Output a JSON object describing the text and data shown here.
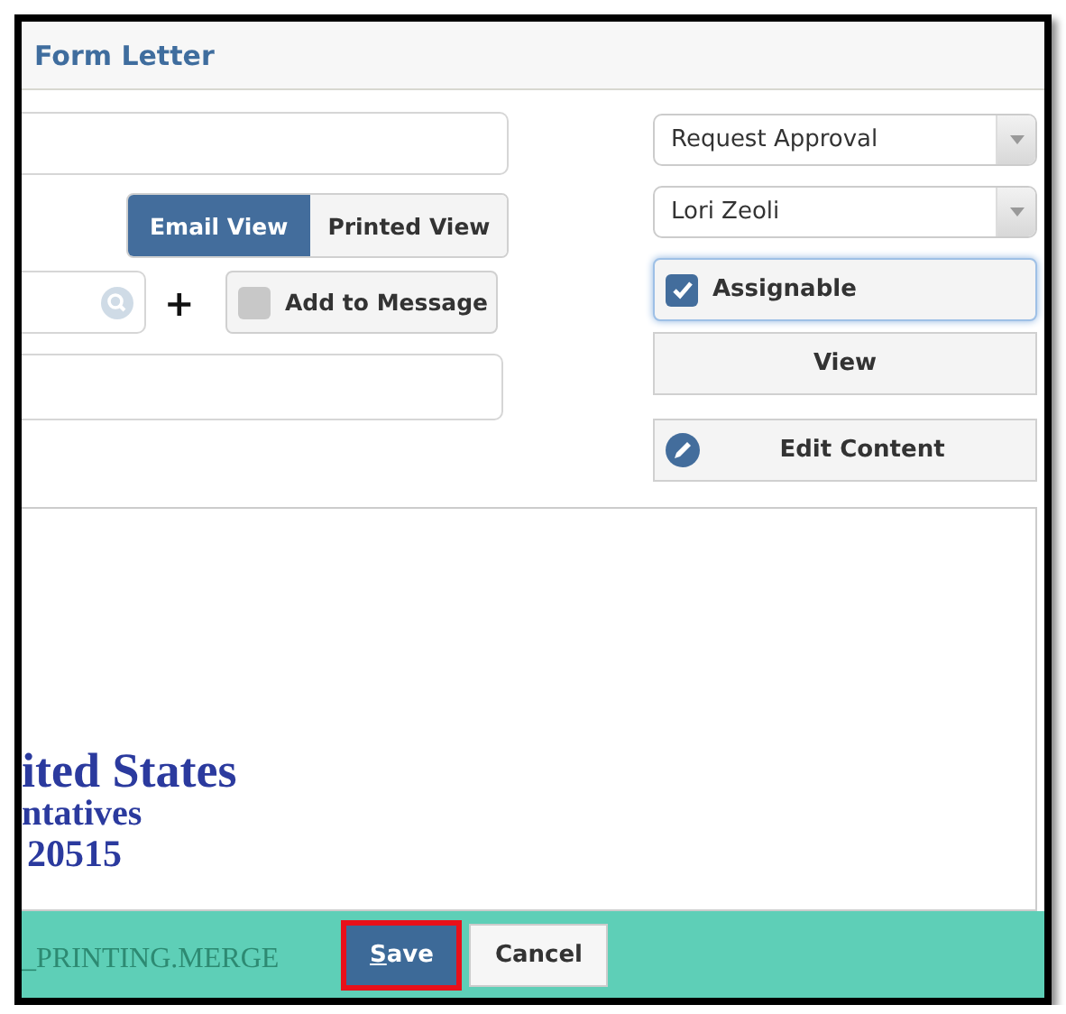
{
  "window": {
    "title": "Form Letter"
  },
  "view_toggle": [
    {
      "label": "Email View",
      "selected": true
    },
    {
      "label": "Printed View",
      "selected": false
    }
  ],
  "add_symbol": "+",
  "add_to_message": {
    "label": "Add to Message",
    "checked": false
  },
  "dropdowns": [
    {
      "value": "Request Approval"
    },
    {
      "value": "Lori Zeoli"
    }
  ],
  "assignable": {
    "label": "Assignable",
    "checked": true
  },
  "actions": [
    {
      "label": "View",
      "kind": "plain"
    },
    {
      "label": "Edit Content",
      "kind": "edit"
    }
  ],
  "document": {
    "letterhead": [
      "ited States",
      "ntatives",
      "20515"
    ]
  },
  "footer": {
    "merge_field": "_PRINTING.MERGE",
    "buttons": [
      {
        "label": "Save",
        "kind": "primary"
      },
      {
        "label": "Cancel",
        "kind": "secondary"
      }
    ]
  }
}
